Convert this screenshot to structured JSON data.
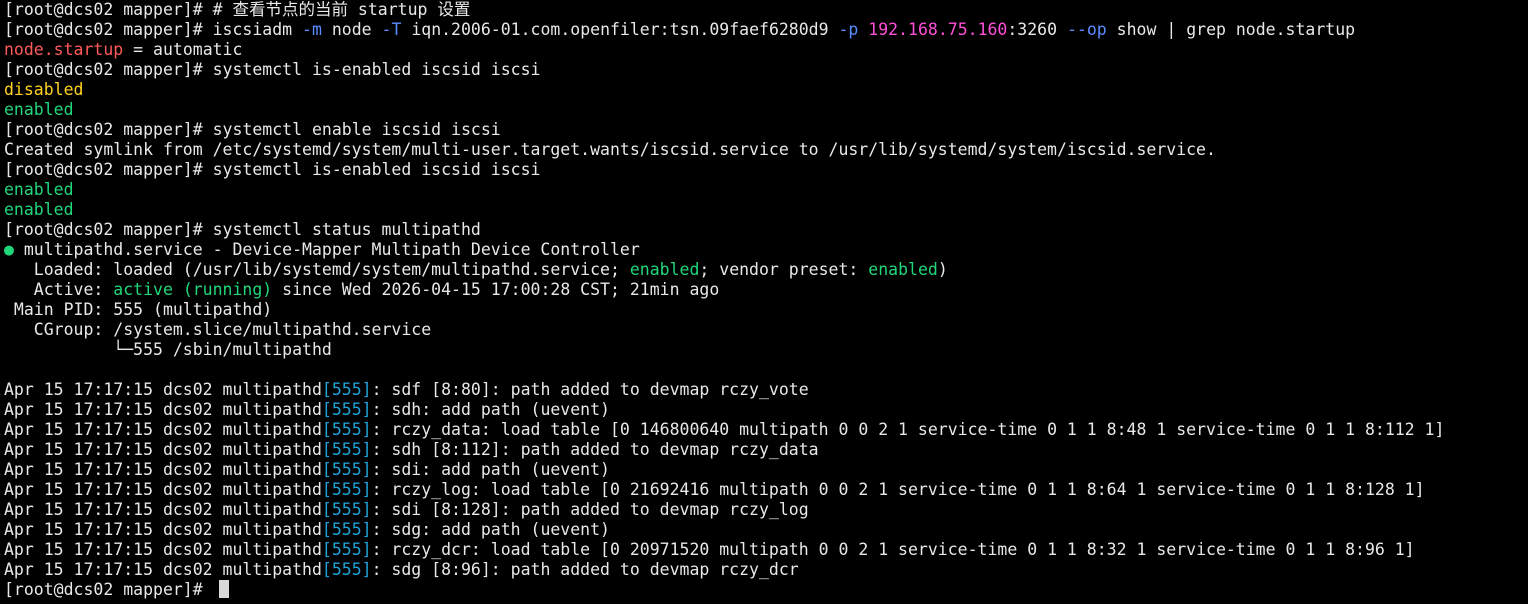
{
  "window": {
    "colors": {
      "background": "#000000",
      "default": "#e8e8e8",
      "flag": "#5b8cff",
      "ip": "#ff4fd8",
      "option": "#ff5a5a",
      "yellow": "#ffd21f",
      "green": "#1fd77a",
      "cyan": "#1fa3d9",
      "cursor": "#d8d8d8"
    }
  },
  "terminal": {
    "prompt": "[root@dcs02 mapper]# ",
    "lines": [
      {
        "segments": [
          {
            "text": "[root@dcs02 mapper]# ",
            "color": "default"
          },
          {
            "text": "# 查看节点的当前 startup 设置",
            "color": "default"
          }
        ]
      },
      {
        "segments": [
          {
            "text": "[root@dcs02 mapper]# ",
            "color": "default"
          },
          {
            "text": "iscsiadm ",
            "color": "default"
          },
          {
            "text": "-m",
            "color": "flag"
          },
          {
            "text": " node ",
            "color": "default"
          },
          {
            "text": "-T",
            "color": "flag"
          },
          {
            "text": " iqn.2006-01.com.openfiler:tsn.09faef6280d9 ",
            "color": "default"
          },
          {
            "text": "-p",
            "color": "flag"
          },
          {
            "text": " ",
            "color": "default"
          },
          {
            "text": "192.168.75.160",
            "color": "ip"
          },
          {
            "text": ":3260 ",
            "color": "default"
          },
          {
            "text": "--op",
            "color": "flag"
          },
          {
            "text": " show | grep node.startup",
            "color": "default"
          }
        ]
      },
      {
        "segments": [
          {
            "text": "node.startup",
            "color": "option"
          },
          {
            "text": " = automatic",
            "color": "default"
          }
        ]
      },
      {
        "segments": [
          {
            "text": "[root@dcs02 mapper]# ",
            "color": "default"
          },
          {
            "text": "systemctl is-enabled iscsid iscsi",
            "color": "default"
          }
        ]
      },
      {
        "segments": [
          {
            "text": "disabled",
            "color": "yellow"
          }
        ]
      },
      {
        "segments": [
          {
            "text": "enabled",
            "color": "green"
          }
        ]
      },
      {
        "segments": [
          {
            "text": "[root@dcs02 mapper]# ",
            "color": "default"
          },
          {
            "text": "systemctl enable iscsid iscsi",
            "color": "default"
          }
        ]
      },
      {
        "segments": [
          {
            "text": "Created symlink from /etc/systemd/system/multi-user.target.wants/iscsid.service to /usr/lib/systemd/system/iscsid.service.",
            "color": "default"
          }
        ]
      },
      {
        "segments": [
          {
            "text": "[root@dcs02 mapper]# ",
            "color": "default"
          },
          {
            "text": "systemctl is-enabled iscsid iscsi",
            "color": "default"
          }
        ]
      },
      {
        "segments": [
          {
            "text": "enabled",
            "color": "green"
          }
        ]
      },
      {
        "segments": [
          {
            "text": "enabled",
            "color": "green"
          }
        ]
      },
      {
        "segments": [
          {
            "text": "[root@dcs02 mapper]# ",
            "color": "default"
          },
          {
            "text": "systemctl status multipathd",
            "color": "default"
          }
        ]
      },
      {
        "segments": [
          {
            "text": "●",
            "color": "green"
          },
          {
            "text": " multipathd.service - Device-Mapper Multipath Device Controller",
            "color": "default"
          }
        ]
      },
      {
        "segments": [
          {
            "text": "   Loaded: loaded (/usr/lib/systemd/system/multipathd.service; ",
            "color": "default"
          },
          {
            "text": "enabled",
            "color": "green"
          },
          {
            "text": "; vendor preset: ",
            "color": "default"
          },
          {
            "text": "enabled",
            "color": "green"
          },
          {
            "text": ")",
            "color": "default"
          }
        ]
      },
      {
        "segments": [
          {
            "text": "   Active: ",
            "color": "default"
          },
          {
            "text": "active (running)",
            "color": "green"
          },
          {
            "text": " since Wed 2026-04-15 17:00:28 CST; 21min ago",
            "color": "default"
          }
        ]
      },
      {
        "segments": [
          {
            "text": " Main PID: 555 (multipathd)",
            "color": "default"
          }
        ]
      },
      {
        "segments": [
          {
            "text": "   CGroup: /system.slice/multipathd.service",
            "color": "default"
          }
        ]
      },
      {
        "segments": [
          {
            "text": "           └─555 /sbin/multipathd",
            "color": "default"
          }
        ]
      },
      {
        "segments": []
      },
      {
        "segments": [
          {
            "text": "Apr 15 17:17:15 dcs02 multipathd",
            "color": "default"
          },
          {
            "text": "[555]",
            "color": "cyan"
          },
          {
            "text": ": sdf [8:80]: path added to devmap rczy_vote",
            "color": "default"
          }
        ]
      },
      {
        "segments": [
          {
            "text": "Apr 15 17:17:15 dcs02 multipathd",
            "color": "default"
          },
          {
            "text": "[555]",
            "color": "cyan"
          },
          {
            "text": ": sdh: add path (uevent)",
            "color": "default"
          }
        ]
      },
      {
        "segments": [
          {
            "text": "Apr 15 17:17:15 dcs02 multipathd",
            "color": "default"
          },
          {
            "text": "[555]",
            "color": "cyan"
          },
          {
            "text": ": rczy_data: load table [0 146800640 multipath 0 0 2 1 service-time 0 1 1 8:48 1 service-time 0 1 1 8:112 1]",
            "color": "default"
          }
        ]
      },
      {
        "segments": [
          {
            "text": "Apr 15 17:17:15 dcs02 multipathd",
            "color": "default"
          },
          {
            "text": "[555]",
            "color": "cyan"
          },
          {
            "text": ": sdh [8:112]: path added to devmap rczy_data",
            "color": "default"
          }
        ]
      },
      {
        "segments": [
          {
            "text": "Apr 15 17:17:15 dcs02 multipathd",
            "color": "default"
          },
          {
            "text": "[555]",
            "color": "cyan"
          },
          {
            "text": ": sdi: add path (uevent)",
            "color": "default"
          }
        ]
      },
      {
        "segments": [
          {
            "text": "Apr 15 17:17:15 dcs02 multipathd",
            "color": "default"
          },
          {
            "text": "[555]",
            "color": "cyan"
          },
          {
            "text": ": rczy_log: load table [0 21692416 multipath 0 0 2 1 service-time 0 1 1 8:64 1 service-time 0 1 1 8:128 1]",
            "color": "default"
          }
        ]
      },
      {
        "segments": [
          {
            "text": "Apr 15 17:17:15 dcs02 multipathd",
            "color": "default"
          },
          {
            "text": "[555]",
            "color": "cyan"
          },
          {
            "text": ": sdi [8:128]: path added to devmap rczy_log",
            "color": "default"
          }
        ]
      },
      {
        "segments": [
          {
            "text": "Apr 15 17:17:15 dcs02 multipathd",
            "color": "default"
          },
          {
            "text": "[555]",
            "color": "cyan"
          },
          {
            "text": ": sdg: add path (uevent)",
            "color": "default"
          }
        ]
      },
      {
        "segments": [
          {
            "text": "Apr 15 17:17:15 dcs02 multipathd",
            "color": "default"
          },
          {
            "text": "[555]",
            "color": "cyan"
          },
          {
            "text": ": rczy_dcr: load table [0 20971520 multipath 0 0 2 1 service-time 0 1 1 8:32 1 service-time 0 1 1 8:96 1]",
            "color": "default"
          }
        ]
      },
      {
        "segments": [
          {
            "text": "Apr 15 17:17:15 dcs02 multipathd",
            "color": "default"
          },
          {
            "text": "[555]",
            "color": "cyan"
          },
          {
            "text": ": sdg [8:96]: path added to devmap rczy_dcr",
            "color": "default"
          }
        ]
      }
    ]
  }
}
